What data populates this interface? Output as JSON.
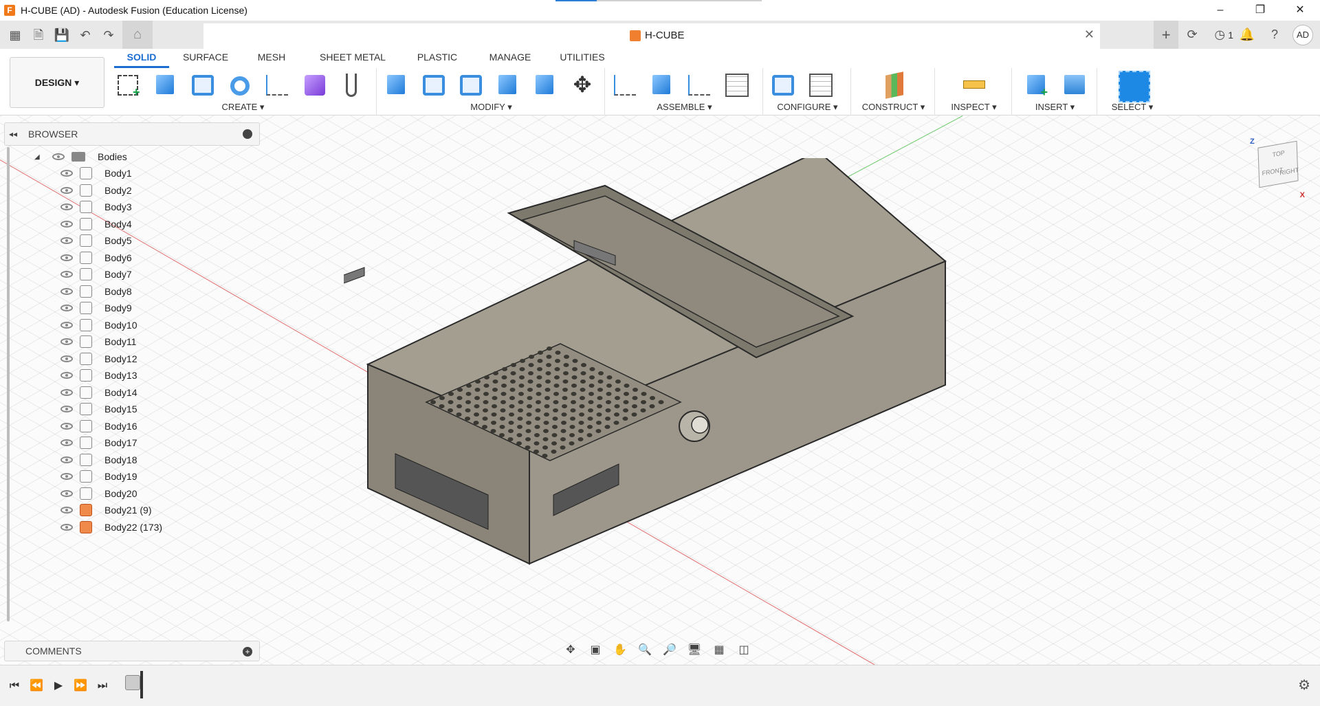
{
  "window": {
    "title": "H-CUBE (AD) - Autodesk Fusion (Education License)",
    "controls": [
      "–",
      "❐",
      "✕"
    ]
  },
  "document_tab": {
    "title": "H-CUBE",
    "close": "✕"
  },
  "quickbar": {
    "job_count": "1",
    "avatar": "AD"
  },
  "workspace": {
    "label": "DESIGN ▾"
  },
  "ribbon_tabs": [
    {
      "label": "SOLID",
      "active": true
    },
    {
      "label": "SURFACE"
    },
    {
      "label": "MESH"
    },
    {
      "label": "SHEET METAL"
    },
    {
      "label": "PLASTIC"
    },
    {
      "label": "MANAGE"
    },
    {
      "label": "UTILITIES"
    }
  ],
  "tool_groups": {
    "create": "CREATE ▾",
    "modify": "MODIFY ▾",
    "assemble": "ASSEMBLE ▾",
    "configure": "CONFIGURE ▾",
    "construct": "CONSTRUCT ▾",
    "inspect": "INSPECT ▾",
    "insert": "INSERT ▾",
    "select": "SELECT ▾"
  },
  "browser": {
    "title": "BROWSER",
    "folder": "Bodies",
    "bodies": [
      "Body1",
      "Body2",
      "Body3",
      "Body4",
      "Body5",
      "Body6",
      "Body7",
      "Body8",
      "Body9",
      "Body10",
      "Body11",
      "Body12",
      "Body13",
      "Body14",
      "Body15",
      "Body16",
      "Body17",
      "Body18",
      "Body19",
      "Body20"
    ],
    "components": [
      "Body21 (9)",
      "Body22 (173)"
    ]
  },
  "comments": {
    "title": "COMMENTS"
  },
  "viewcube": {
    "top": "TOP",
    "front": "FRONT",
    "right": "RIGHT",
    "z": "Z",
    "x": "X"
  },
  "colors": {
    "accent": "#1b6ed0",
    "model": "#8f8a7d"
  }
}
